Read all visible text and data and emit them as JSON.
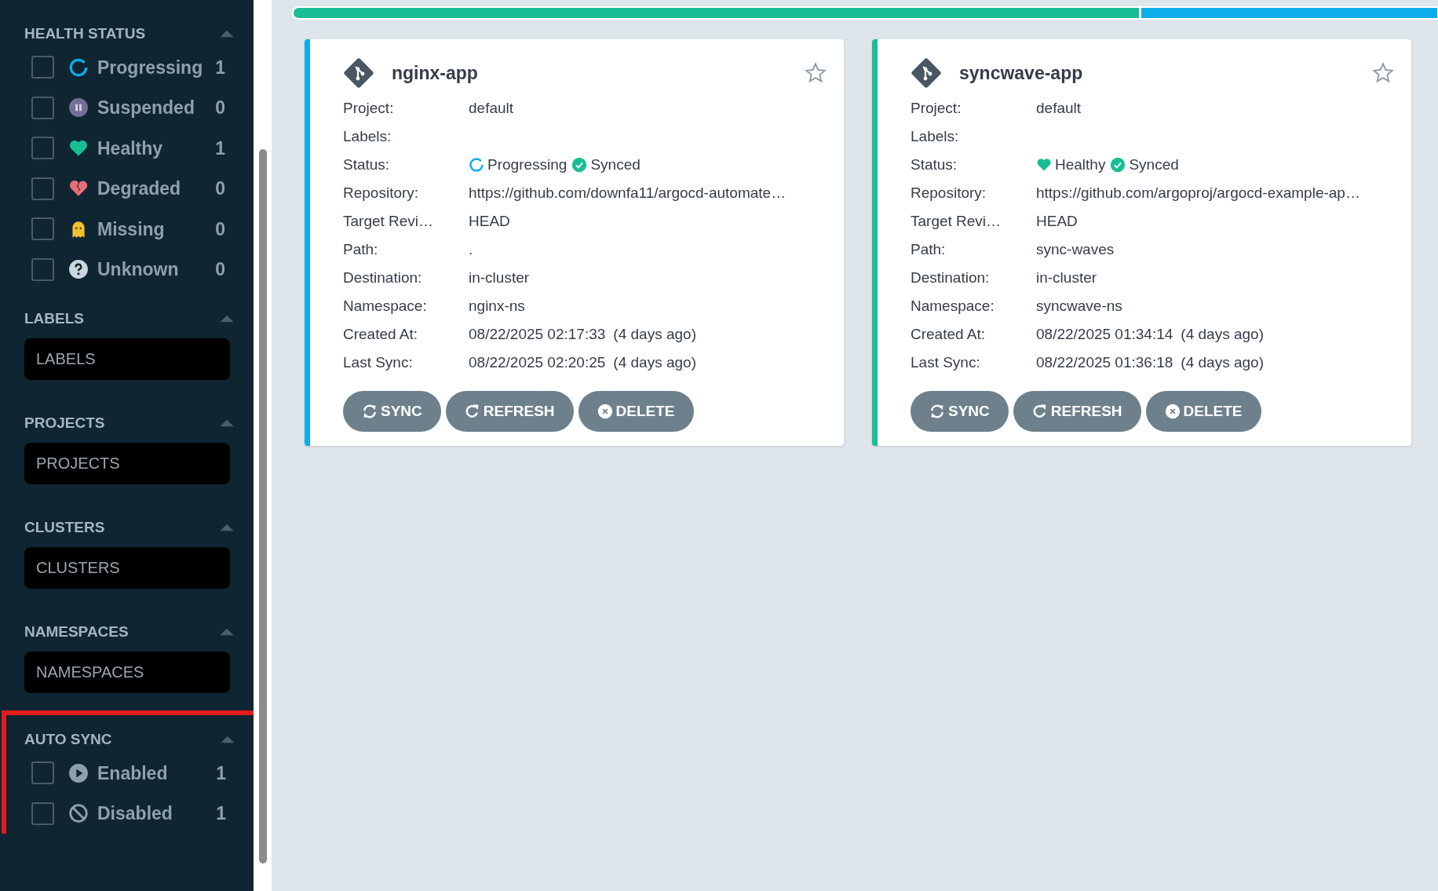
{
  "sidebar": {
    "sections": [
      {
        "title": "HEALTH STATUS",
        "expanded": true,
        "highlighted": false,
        "kind": "checklist",
        "items": [
          {
            "kind": "progressing",
            "label": "Progressing",
            "count": "1",
            "checked": false
          },
          {
            "kind": "suspended",
            "label": "Suspended",
            "count": "0",
            "checked": false
          },
          {
            "kind": "healthy",
            "label": "Healthy",
            "count": "1",
            "checked": false
          },
          {
            "kind": "degraded",
            "label": "Degraded",
            "count": "0",
            "checked": false
          },
          {
            "kind": "missing",
            "label": "Missing",
            "count": "0",
            "checked": false
          },
          {
            "kind": "unknown",
            "label": "Unknown",
            "count": "0",
            "checked": false
          }
        ]
      },
      {
        "title": "LABELS",
        "expanded": true,
        "highlighted": false,
        "kind": "field",
        "placeholder": "LABELS"
      },
      {
        "title": "PROJECTS",
        "expanded": true,
        "highlighted": false,
        "kind": "field",
        "placeholder": "PROJECTS"
      },
      {
        "title": "CLUSTERS",
        "expanded": true,
        "highlighted": false,
        "kind": "field",
        "placeholder": "CLUSTERS"
      },
      {
        "title": "NAMESPACES",
        "expanded": true,
        "highlighted": false,
        "kind": "field",
        "placeholder": "NAMESPACES"
      },
      {
        "title": "AUTO SYNC",
        "expanded": true,
        "highlighted": true,
        "kind": "checklist",
        "items": [
          {
            "kind": "enabled",
            "label": "Enabled",
            "count": "1",
            "checked": false
          },
          {
            "kind": "disabled",
            "label": "Disabled",
            "count": "1",
            "checked": false
          }
        ]
      }
    ]
  },
  "status_bar": {
    "segments": [
      {
        "color": "#18be94",
        "level": 0.74
      },
      {
        "color": "#0dadea",
        "level": 0.26
      }
    ]
  },
  "apps": [
    {
      "name": "nginx-app",
      "color": "#0dadea",
      "starred": false,
      "rows": [
        {
          "label": "Project:",
          "value": "default"
        },
        {
          "label": "Labels:"
        },
        {
          "label": "Status:",
          "kind": "status",
          "health": {
            "kind": "progressing",
            "text": "Progressing"
          },
          "sync": {
            "kind": "synced",
            "text": "Synced"
          }
        },
        {
          "label": "Repository:",
          "value": "https://github.com/downfa11/argocd-automate…"
        },
        {
          "label": "Target Revi…",
          "value": "HEAD"
        },
        {
          "label": "Path:",
          "value": "."
        },
        {
          "label": "Destination:",
          "value": "in-cluster"
        },
        {
          "label": "Namespace:",
          "value": "nginx-ns"
        },
        {
          "label": "Created At:",
          "value": "08/22/2025 02:17:33",
          "note": "(4 days ago)"
        },
        {
          "label": "Last Sync:",
          "value": "08/22/2025 02:20:25",
          "note": "(4 days ago)"
        }
      ],
      "buttons": [
        {
          "kind": "sync",
          "label": "SYNC"
        },
        {
          "kind": "refresh",
          "label": "REFRESH"
        },
        {
          "kind": "delete",
          "label": "DELETE"
        }
      ]
    },
    {
      "name": "syncwave-app",
      "color": "#18be94",
      "starred": false,
      "rows": [
        {
          "label": "Project:",
          "value": "default"
        },
        {
          "label": "Labels:"
        },
        {
          "label": "Status:",
          "kind": "status",
          "health": {
            "kind": "healthy",
            "text": "Healthy"
          },
          "sync": {
            "kind": "synced",
            "text": "Synced"
          }
        },
        {
          "label": "Repository:",
          "value": "https://github.com/argoproj/argocd-example-ap…"
        },
        {
          "label": "Target Revi…",
          "value": "HEAD"
        },
        {
          "label": "Path:",
          "value": "sync-waves"
        },
        {
          "label": "Destination:",
          "value": "in-cluster"
        },
        {
          "label": "Namespace:",
          "value": "syncwave-ns"
        },
        {
          "label": "Created At:",
          "value": "08/22/2025 01:34:14",
          "note": "(4 days ago)"
        },
        {
          "label": "Last Sync:",
          "value": "08/22/2025 01:36:18",
          "note": "(4 days ago)"
        }
      ],
      "buttons": [
        {
          "kind": "sync",
          "label": "SYNC"
        },
        {
          "kind": "refresh",
          "label": "REFRESH"
        },
        {
          "kind": "delete",
          "label": "DELETE"
        }
      ]
    }
  ]
}
